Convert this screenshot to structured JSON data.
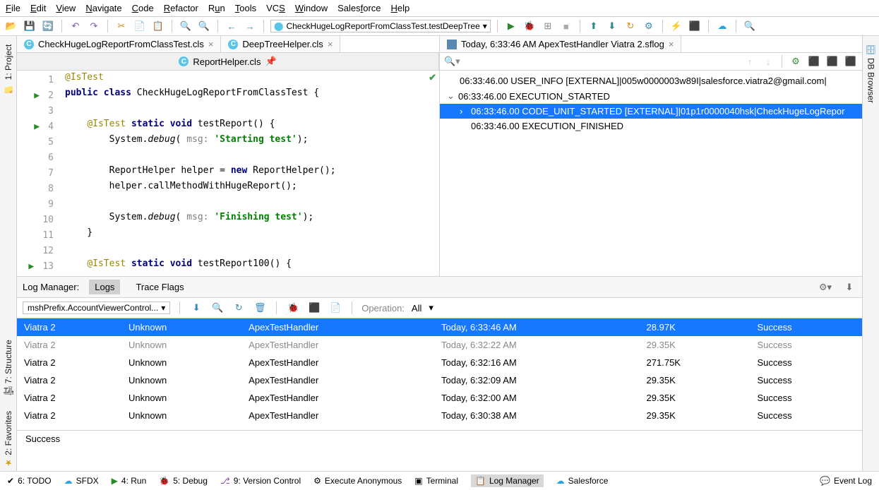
{
  "menu": {
    "file": "File",
    "edit": "Edit",
    "view": "View",
    "navigate": "Navigate",
    "code": "Code",
    "refactor": "Refactor",
    "run": "Run",
    "tools": "Tools",
    "vcs": "VCS",
    "window": "Window",
    "salesforce": "Salesforce",
    "help": "Help"
  },
  "run_config": "CheckHugeLogReportFromClassTest.testDeepTree",
  "tabs": {
    "t1": "CheckHugeLogReportFromClassTest.cls",
    "t2": "DeepTreeHelper.cls",
    "t3": "Today, 6:33:46 AM ApexTestHandler Viatra 2.sflog",
    "t4": "ReportHelper.cls"
  },
  "code": {
    "l1_anno": "@IsTest",
    "l2_pub": "public",
    "l2_class": "class",
    "l2_name": "CheckHugeLogReportFromClassTest {",
    "l4_anno": "@IsTest",
    "l4_static": "static",
    "l4_void": "void",
    "l4_fn": "testReport() {",
    "l5_pre": "        System.",
    "l5_debug": "debug",
    "l5_p": "( ",
    "l5_msg": "msg:",
    "l5_sp": " ",
    "l5_str": "'Starting test'",
    "l5_end": ");",
    "l7": "        ReportHelper helper = ",
    "l7_new": "new",
    "l7_end": " ReportHelper();",
    "l8": "        helper.callMethodWithHugeReport();",
    "l10_pre": "        System.",
    "l10_debug": "debug",
    "l10_p": "( ",
    "l10_msg": "msg:",
    "l10_sp": " ",
    "l10_str": "'Finishing test'",
    "l10_end": ");",
    "l11": "    }",
    "l13_anno": "@IsTest",
    "l13_static": "static",
    "l13_void": "void",
    "l13_fn": "testReport100() {"
  },
  "log_search_placeholder": "",
  "log_tree": {
    "r1": "06:33:46.00 USER_INFO [EXTERNAL]|005w0000003w89I|salesforce.viatra2@gmail.com|",
    "r2": "06:33:46.00 EXECUTION_STARTED",
    "r3": "06:33:46.00 CODE_UNIT_STARTED [EXTERNAL]|01p1r0000040hsk|CheckHugeLogRepor",
    "r4": "06:33:46.00 EXECUTION_FINISHED"
  },
  "logs_panel": {
    "title": "Log Manager:",
    "tab_logs": "Logs",
    "tab_trace": "Trace Flags",
    "filter": "mshPrefix.AccountViewerControl...",
    "op_label": "Operation:",
    "op_val": "All"
  },
  "rows": [
    {
      "a": "Viatra 2",
      "b": "Unknown",
      "c": "ApexTestHandler",
      "d": "Today, 6:33:46 AM",
      "e": "28.97K",
      "f": "Success"
    },
    {
      "a": "Viatra 2",
      "b": "Unknown",
      "c": "ApexTestHandler",
      "d": "Today, 6:32:22 AM",
      "e": "29.35K",
      "f": "Success"
    },
    {
      "a": "Viatra 2",
      "b": "Unknown",
      "c": "ApexTestHandler",
      "d": "Today, 6:32:16 AM",
      "e": "271.75K",
      "f": "Success"
    },
    {
      "a": "Viatra 2",
      "b": "Unknown",
      "c": "ApexTestHandler",
      "d": "Today, 6:32:09 AM",
      "e": "29.35K",
      "f": "Success"
    },
    {
      "a": "Viatra 2",
      "b": "Unknown",
      "c": "ApexTestHandler",
      "d": "Today, 6:32:00 AM",
      "e": "29.35K",
      "f": "Success"
    },
    {
      "a": "Viatra 2",
      "b": "Unknown",
      "c": "ApexTestHandler",
      "d": "Today, 6:30:38 AM",
      "e": "29.35K",
      "f": "Success"
    }
  ],
  "status": "Success",
  "bottom": {
    "todo": "6: TODO",
    "sfdx": "SFDX",
    "run": "4: Run",
    "debug": "5: Debug",
    "vc": "9: Version Control",
    "exec": "Execute Anonymous",
    "term": "Terminal",
    "logm": "Log Manager",
    "sf": "Salesforce",
    "evlog": "Event Log"
  },
  "side": {
    "project": "1: Project",
    "structure": "7: Structure",
    "favorites": "2: Favorites",
    "db": "DB Browser"
  }
}
